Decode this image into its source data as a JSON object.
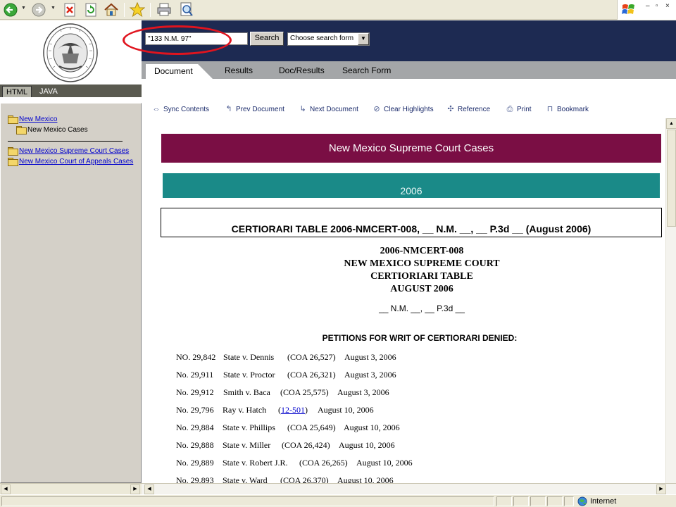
{
  "toolbar": {
    "icons": [
      "back-icon",
      "forward-icon",
      "stop-icon",
      "refresh-icon",
      "home-icon",
      "favorites-icon",
      "print-icon",
      "print-preview-icon"
    ]
  },
  "window_controls": {
    "minimize": "–",
    "restore": "▫",
    "close": "×"
  },
  "left_frame": {
    "tabs": [
      {
        "label": "HTML",
        "active": true
      },
      {
        "label": "JAVA",
        "active": false
      }
    ],
    "tree": [
      {
        "label": "New Mexico",
        "link": true
      },
      {
        "label": "New Mexico Cases",
        "link": false
      },
      {
        "label": "New Mexico Supreme Court Cases",
        "link": true
      },
      {
        "label": "New Mexico Court of Appeals Cases",
        "link": true
      }
    ]
  },
  "search": {
    "value": "\"133 N.M. 97\"",
    "button_label": "Search",
    "form_select": "Choose search form"
  },
  "main_tabs": [
    {
      "label": "Document",
      "active": true
    },
    {
      "label": "Results",
      "active": false
    },
    {
      "label": "Doc/Results",
      "active": false
    },
    {
      "label": "Search Form",
      "active": false
    }
  ],
  "actions": [
    {
      "label": "Sync Contents",
      "icon": "sync-arrows-icon"
    },
    {
      "label": "Prev Document",
      "icon": "prev-document-icon"
    },
    {
      "label": "Next Document",
      "icon": "next-document-icon"
    },
    {
      "label": "Clear Highlights",
      "icon": "clear-highlights-icon"
    },
    {
      "label": "Reference",
      "icon": "reference-icon"
    },
    {
      "label": "Print",
      "icon": "print-icon"
    },
    {
      "label": "Bookmark",
      "icon": "bookmark-icon"
    }
  ],
  "document": {
    "court_banner": "New Mexico Supreme Court Cases",
    "year_banner": "2006",
    "cert_title": "CERTIORARI TABLE 2006-NMCERT-008, __ N.M. __, __ P.3d __ (August 2006)",
    "heading_lines": [
      "2006-NMCERT-008",
      "NEW MEXICO SUPREME COURT",
      "CERTIORIARI TABLE",
      "AUGUST 2006"
    ],
    "cite_line": "__ N.M. __, __ P.3d __",
    "section_heading": "PETITIONS FOR WRIT OF CERTIORARI DENIED:",
    "rows": [
      {
        "no": "NO. 29,842",
        "case": "State v. Dennis",
        "ref": "(COA 26,527)",
        "date": "August 3, 2006"
      },
      {
        "no": "No. 29,911",
        "case": "State v. Proctor",
        "ref": "(COA 26,321)",
        "date": "August 3, 2006"
      },
      {
        "no": "No. 29,912",
        "case": "Smith v. Baca",
        "ref": "(COA 25,575)",
        "date": "August 3, 2006"
      },
      {
        "no": "No. 29,796",
        "case": "Ray v. Hatch",
        "ref_prefix": "(",
        "ref_link": "12-501",
        "ref_suffix": ")",
        "date": "August 10, 2006"
      },
      {
        "no": "No. 29,884",
        "case": "State v. Phillips",
        "ref": "(COA 25,649)",
        "date": "August 10, 2006"
      },
      {
        "no": "No. 29,888",
        "case": "State v. Miller",
        "ref": "(COA 26,424)",
        "date": "August 10, 2006"
      },
      {
        "no": "No. 29,889",
        "case": "State v. Robert J.R.",
        "ref": "(COA 26,265)",
        "date": "August 10, 2006"
      },
      {
        "no": "No. 29,893",
        "case": "State v. Ward",
        "ref": "(COA 26,370)",
        "date": "August 10, 2006"
      }
    ]
  },
  "status": {
    "zone": "Internet"
  },
  "colors": {
    "banner_maroon": "#7a0e44",
    "banner_teal": "#1a8a88",
    "search_bg": "#1d2a52",
    "highlight_oval": "#e0141e"
  }
}
